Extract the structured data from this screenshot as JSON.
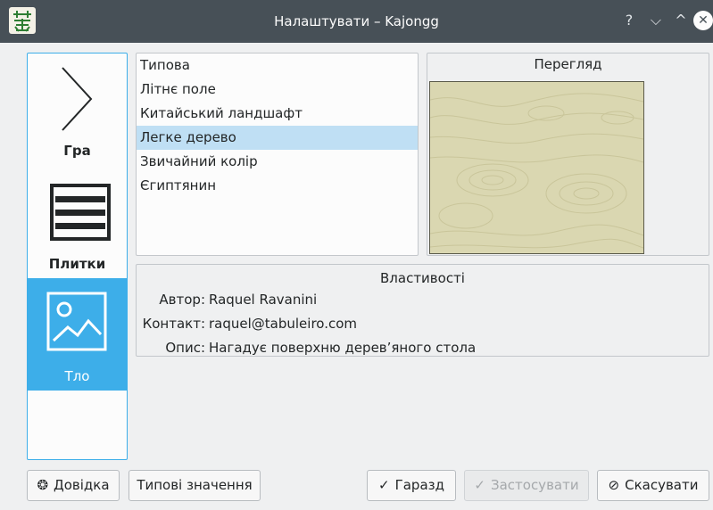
{
  "window": {
    "title": "Налаштувати – Kajongg",
    "help_glyph": "?",
    "minimize_glyph": "⌵",
    "maximize_glyph": "^",
    "close_glyph": "✕"
  },
  "sidebar": {
    "items": [
      {
        "label": "Гра",
        "icon": "chevron-right-icon"
      },
      {
        "label": "Плитки",
        "icon": "tiles-icon"
      },
      {
        "label": "Тло",
        "icon": "image-icon",
        "selected": true
      }
    ]
  },
  "backgrounds": {
    "items": [
      "Типова",
      "Літнє поле",
      "Китайський ландшафт",
      "Легке дерево",
      "Звичайний колір",
      "Єгиптянин"
    ],
    "selected_index": 3
  },
  "preview": {
    "title": "Перегляд"
  },
  "properties": {
    "title": "Властивості",
    "author_label": "Автор:",
    "author_value": "Raquel Ravanini",
    "contact_label": "Контакт:",
    "contact_value": "raquel@tabuleiro.com",
    "description_label": "Опис:",
    "description_value": "Нагадує поверхню дерев’яного стола"
  },
  "buttons": {
    "help": "Довідка",
    "help_glyph": "❂",
    "defaults": "Типові значення",
    "ok": "Гаразд",
    "ok_glyph": "✓",
    "apply": "Застосувати",
    "apply_glyph": "✓",
    "cancel": "Скасувати",
    "cancel_glyph": "⊘"
  },
  "colors": {
    "accent": "#3daee9",
    "titlebar": "#475057",
    "selection": "#bfdff4",
    "wood": "#dad7b1"
  }
}
